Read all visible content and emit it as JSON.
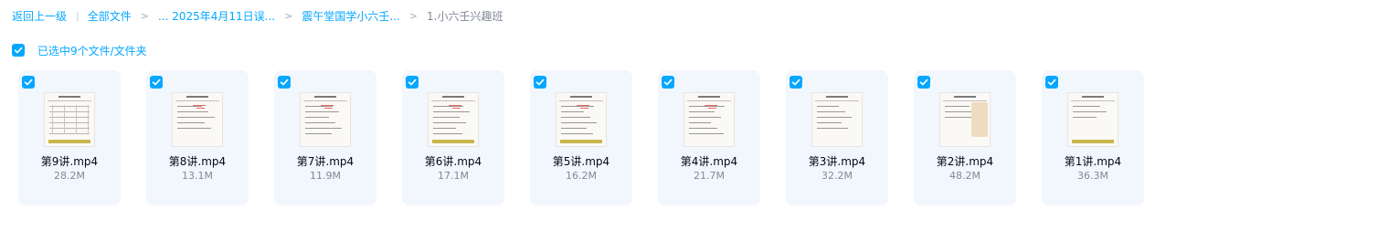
{
  "breadcrumb": {
    "back": "返回上一级",
    "all_files": "全部文件",
    "folder_1": "... 2025年4月11日误...",
    "folder_2": "震午堂国学小六壬...",
    "current": "1.小六壬兴趣班"
  },
  "selection": {
    "text": "已选中9个文件/文件夹",
    "checked": true
  },
  "accent_color": "#06a7ff",
  "files": [
    {
      "name": "第9讲.mp4",
      "size": "28.2M",
      "selected": true
    },
    {
      "name": "第8讲.mp4",
      "size": "13.1M",
      "selected": true
    },
    {
      "name": "第7讲.mp4",
      "size": "11.9M",
      "selected": true
    },
    {
      "name": "第6讲.mp4",
      "size": "17.1M",
      "selected": true
    },
    {
      "name": "第5讲.mp4",
      "size": "16.2M",
      "selected": true
    },
    {
      "name": "第4讲.mp4",
      "size": "21.7M",
      "selected": true
    },
    {
      "name": "第3讲.mp4",
      "size": "32.2M",
      "selected": true
    },
    {
      "name": "第2讲.mp4",
      "size": "48.2M",
      "selected": true
    },
    {
      "name": "第1讲.mp4",
      "size": "36.3M",
      "selected": true
    }
  ]
}
